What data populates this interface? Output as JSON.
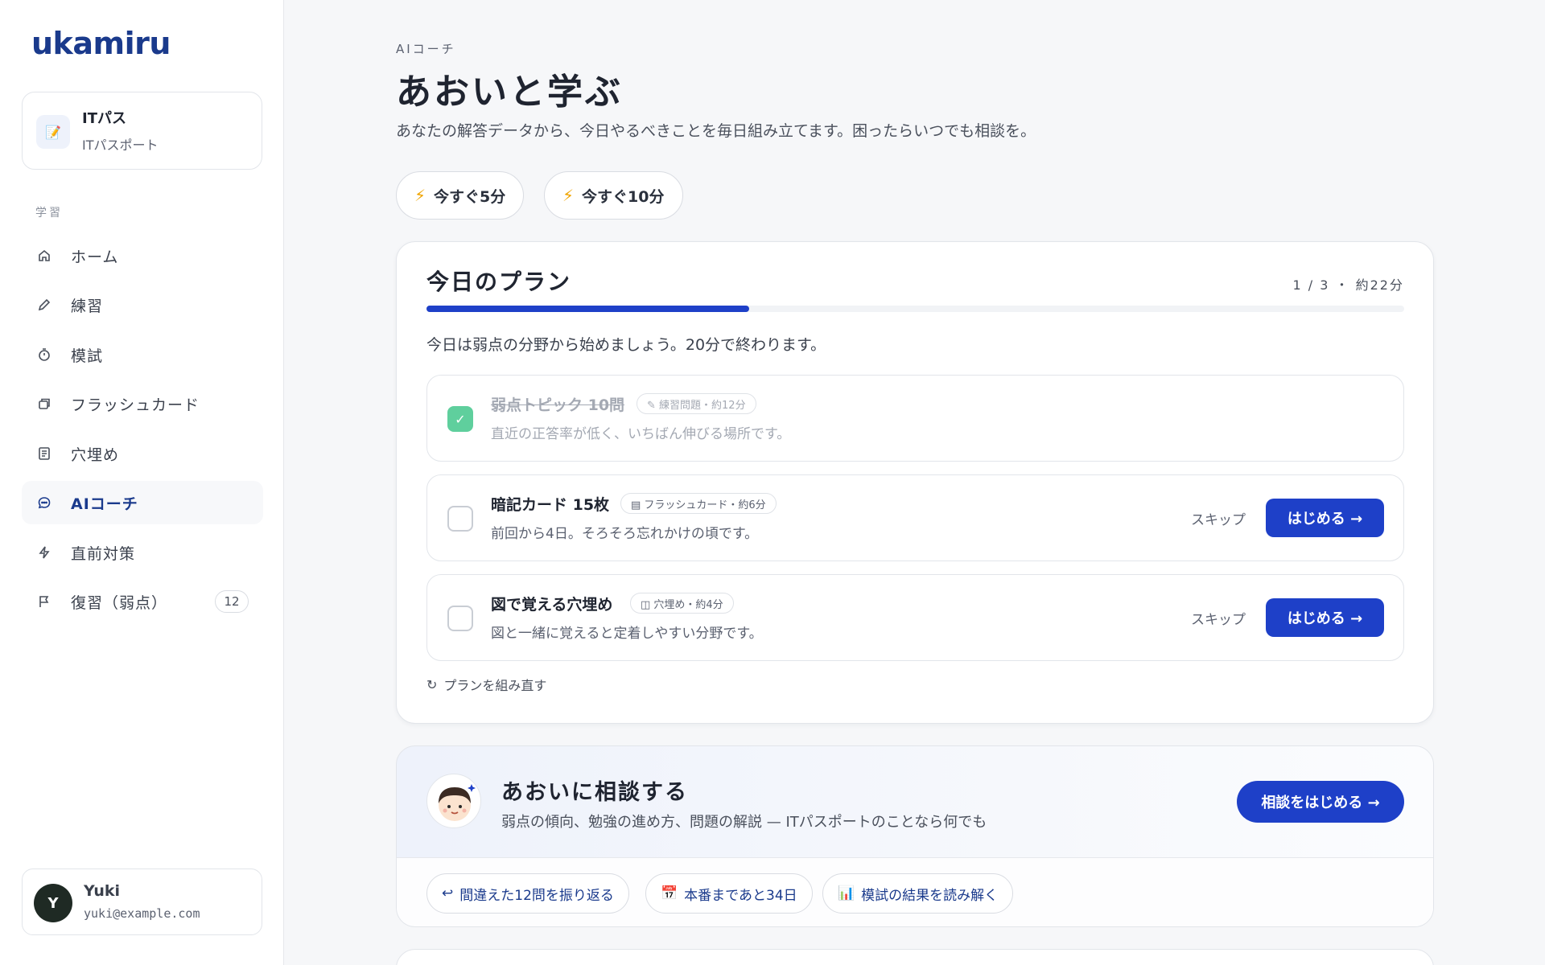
{
  "brand": {
    "logo": "ukamiru"
  },
  "course": {
    "icon": "📝",
    "title": "ITパス",
    "subtitle": "ITパスポート"
  },
  "sidebar": {
    "section_label": "学習",
    "items": [
      {
        "label": "ホーム",
        "icon": "home-icon"
      },
      {
        "label": "練習",
        "icon": "pencil-icon"
      },
      {
        "label": "模試",
        "icon": "timer-icon"
      },
      {
        "label": "フラッシュカード",
        "icon": "cards-icon"
      },
      {
        "label": "穴埋め",
        "icon": "document-icon"
      },
      {
        "label": "AIコーチ",
        "icon": "chat-icon",
        "active": true
      },
      {
        "label": "直前対策",
        "icon": "bolt-icon"
      },
      {
        "label": "復習（弱点）",
        "icon": "flag-icon",
        "badge": "12"
      }
    ]
  },
  "user": {
    "initial": "Y",
    "name": "Yuki",
    "email": "yuki@example.com"
  },
  "header": {
    "eyebrow": "AIコーチ",
    "title": "あおいと学ぶ",
    "description": "あなたの解答データから、今日やるべきことを毎日組み立てます。困ったらいつでも相談を。"
  },
  "quick_actions": [
    {
      "label": "今すぐ5分"
    },
    {
      "label": "今すぐ10分"
    }
  ],
  "plan": {
    "title": "今日のプラン",
    "meta": "1 / 3 ・ 約22分",
    "progress": 0.33,
    "intro": "今日は弱点の分野から始めましょう。20分で終わります。",
    "tasks": [
      {
        "title": "弱点トピック 10問",
        "tag": "✎ 練習問題・約12分",
        "desc": "直近の正答率が低く、いちばん伸びる場所です。",
        "done": true
      },
      {
        "title": "暗記カード 15枚",
        "tag": "▤ フラッシュカード・約6分",
        "desc": "前回から4日。そろそろ忘れかけの頃です。",
        "done": false,
        "skip": "スキップ",
        "start": "はじめる →"
      },
      {
        "title": "図で覚える穴埋め",
        "tag": "◫ 穴埋め・約4分",
        "desc": "図と一緒に覚えると定着しやすい分野です。",
        "done": false,
        "skip": "スキップ",
        "start": "はじめる →"
      }
    ],
    "replan": "プランを組み直す"
  },
  "consult": {
    "title": "あおいに相談する",
    "description": "弱点の傾向、勉強の進め方、問題の解説 — ITパスポートのことなら何でも",
    "button": "相談をはじめる →",
    "chips": [
      {
        "icon": "↩",
        "label": "間違えた12問を振り返る"
      },
      {
        "icon": "📅",
        "label": "本番まであと34日"
      },
      {
        "icon": "📊",
        "label": "模試の結果を読み解く"
      }
    ]
  },
  "colors": {
    "accent": "#1e40c8",
    "brand": "#1a3a8c",
    "done": "#5fcf9d"
  }
}
